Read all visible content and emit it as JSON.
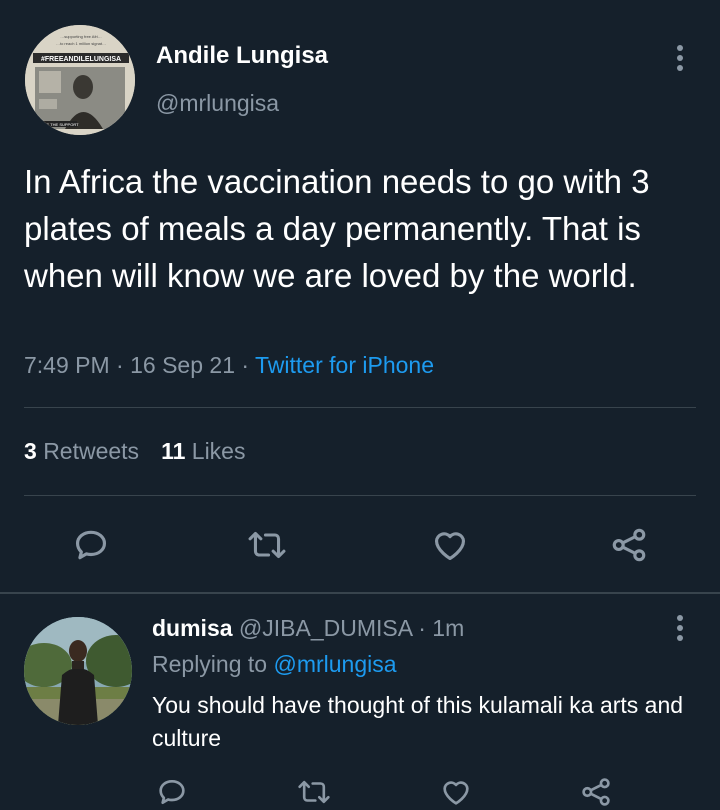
{
  "main_tweet": {
    "author_name": "Andile Lungisa",
    "author_handle": "@mrlungisa",
    "avatar_poster": {
      "headline": "#FREEANDILELUNGISA",
      "top_line": "…supporting free Afri… …to reach 1 million signat…",
      "bottom_line": "SHARE THE SUPPORT"
    },
    "text": "In Africa the vaccination needs to go with 3 plates of meals a day permanently. That is when will know we are loved by the world.",
    "time": "7:49 PM",
    "date": "16 Sep 21",
    "source": "Twitter for iPhone",
    "retweets_count": "3",
    "retweets_label": "Retweets",
    "likes_count": "11",
    "likes_label": "Likes",
    "actions": [
      "reply-icon",
      "retweet-icon",
      "like-icon",
      "share-icon"
    ]
  },
  "reply": {
    "author_name": "dumisa",
    "author_handle": "@JIBA_DUMISA",
    "time": "1m",
    "replying_label": "Replying to",
    "replying_mention": "@mrlungisa",
    "text": "You should have thought of this kulamali ka arts and culture",
    "actions": [
      "reply-icon",
      "retweet-icon",
      "like-icon",
      "share-icon"
    ]
  },
  "colors": {
    "background": "#15202b",
    "text_primary": "#ffffff",
    "text_secondary": "#8b98a5",
    "accent": "#1d9bf0",
    "divider": "#38444d"
  }
}
